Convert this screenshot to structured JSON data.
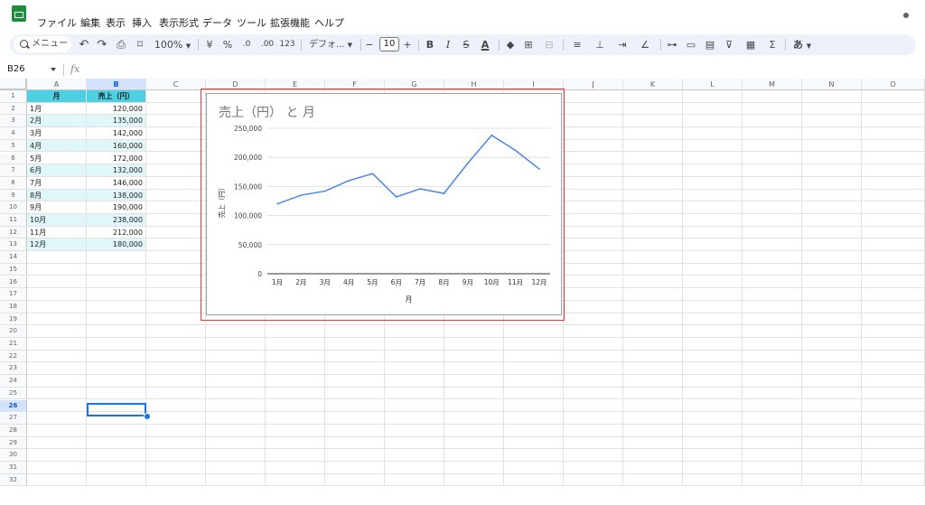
{
  "menu": [
    "ファイル",
    "編集",
    "表示",
    "挿入",
    "表示形式",
    "データ",
    "ツール",
    "拡張機能",
    "ヘルプ"
  ],
  "toolbar": {
    "search": "メニュー",
    "zoom": "100%",
    "currency": "¥",
    "percent": "%",
    "dec_less": ".0",
    "dec_more": ".00",
    "number_format": "123",
    "font": "デフォ...",
    "minus": "−",
    "font_size": "10",
    "plus": "+",
    "bold": "B",
    "italic": "I",
    "strike": "S",
    "text_color": "A",
    "sigma": "Σ",
    "input_tool": "あ"
  },
  "formula_bar": {
    "name_box": "B26",
    "fx": "fx"
  },
  "sheet": {
    "columns": [
      "A",
      "B",
      "C",
      "D",
      "E",
      "F",
      "G",
      "H",
      "I",
      "J",
      "K",
      "L",
      "M",
      "N",
      "O"
    ],
    "selected_column": "B",
    "selected_row": 26,
    "row_numbers": [
      "1",
      "2",
      "3",
      "4",
      "5",
      "6",
      "7",
      "8",
      "9",
      "10",
      "11",
      "12",
      "13",
      "14",
      "15",
      "16",
      "17",
      "18",
      "19",
      "20",
      "21",
      "22",
      "23",
      "24",
      "25",
      "26",
      "27",
      "28",
      "29",
      "30",
      "31",
      "32"
    ],
    "header": {
      "a": "月",
      "b": "売上（円）"
    },
    "rows": [
      {
        "month": "1月",
        "sales": "120,000"
      },
      {
        "month": "2月",
        "sales": "135,000"
      },
      {
        "month": "3月",
        "sales": "142,000"
      },
      {
        "month": "4月",
        "sales": "160,000"
      },
      {
        "month": "5月",
        "sales": "172,000"
      },
      {
        "month": "6月",
        "sales": "132,000"
      },
      {
        "month": "7月",
        "sales": "146,000"
      },
      {
        "month": "8月",
        "sales": "138,000"
      },
      {
        "month": "9月",
        "sales": "190,000"
      },
      {
        "month": "10月",
        "sales": "238,000"
      },
      {
        "month": "11月",
        "sales": "212,000"
      },
      {
        "month": "12月",
        "sales": "180,000"
      }
    ],
    "header_color": "#4dd0e1",
    "alt_row_color": "#e0f7fa"
  },
  "chart_data": {
    "type": "line",
    "title": "売上（円） と 月",
    "xlabel": "月",
    "ylabel": "売上（円）",
    "categories": [
      "1月",
      "2月",
      "3月",
      "4月",
      "5月",
      "6月",
      "7月",
      "8月",
      "9月",
      "10月",
      "11月",
      "12月"
    ],
    "series": [
      {
        "values": [
          120000,
          135000,
          142000,
          160000,
          172000,
          132000,
          146000,
          138000,
          190000,
          238000,
          212000,
          180000
        ],
        "color": "#4a86e8"
      }
    ],
    "ylim": [
      0,
      250000
    ],
    "yticks": [
      "0",
      "50,000",
      "100,000",
      "150,000",
      "200,000",
      "250,000"
    ],
    "grid": true,
    "legend": "none"
  }
}
